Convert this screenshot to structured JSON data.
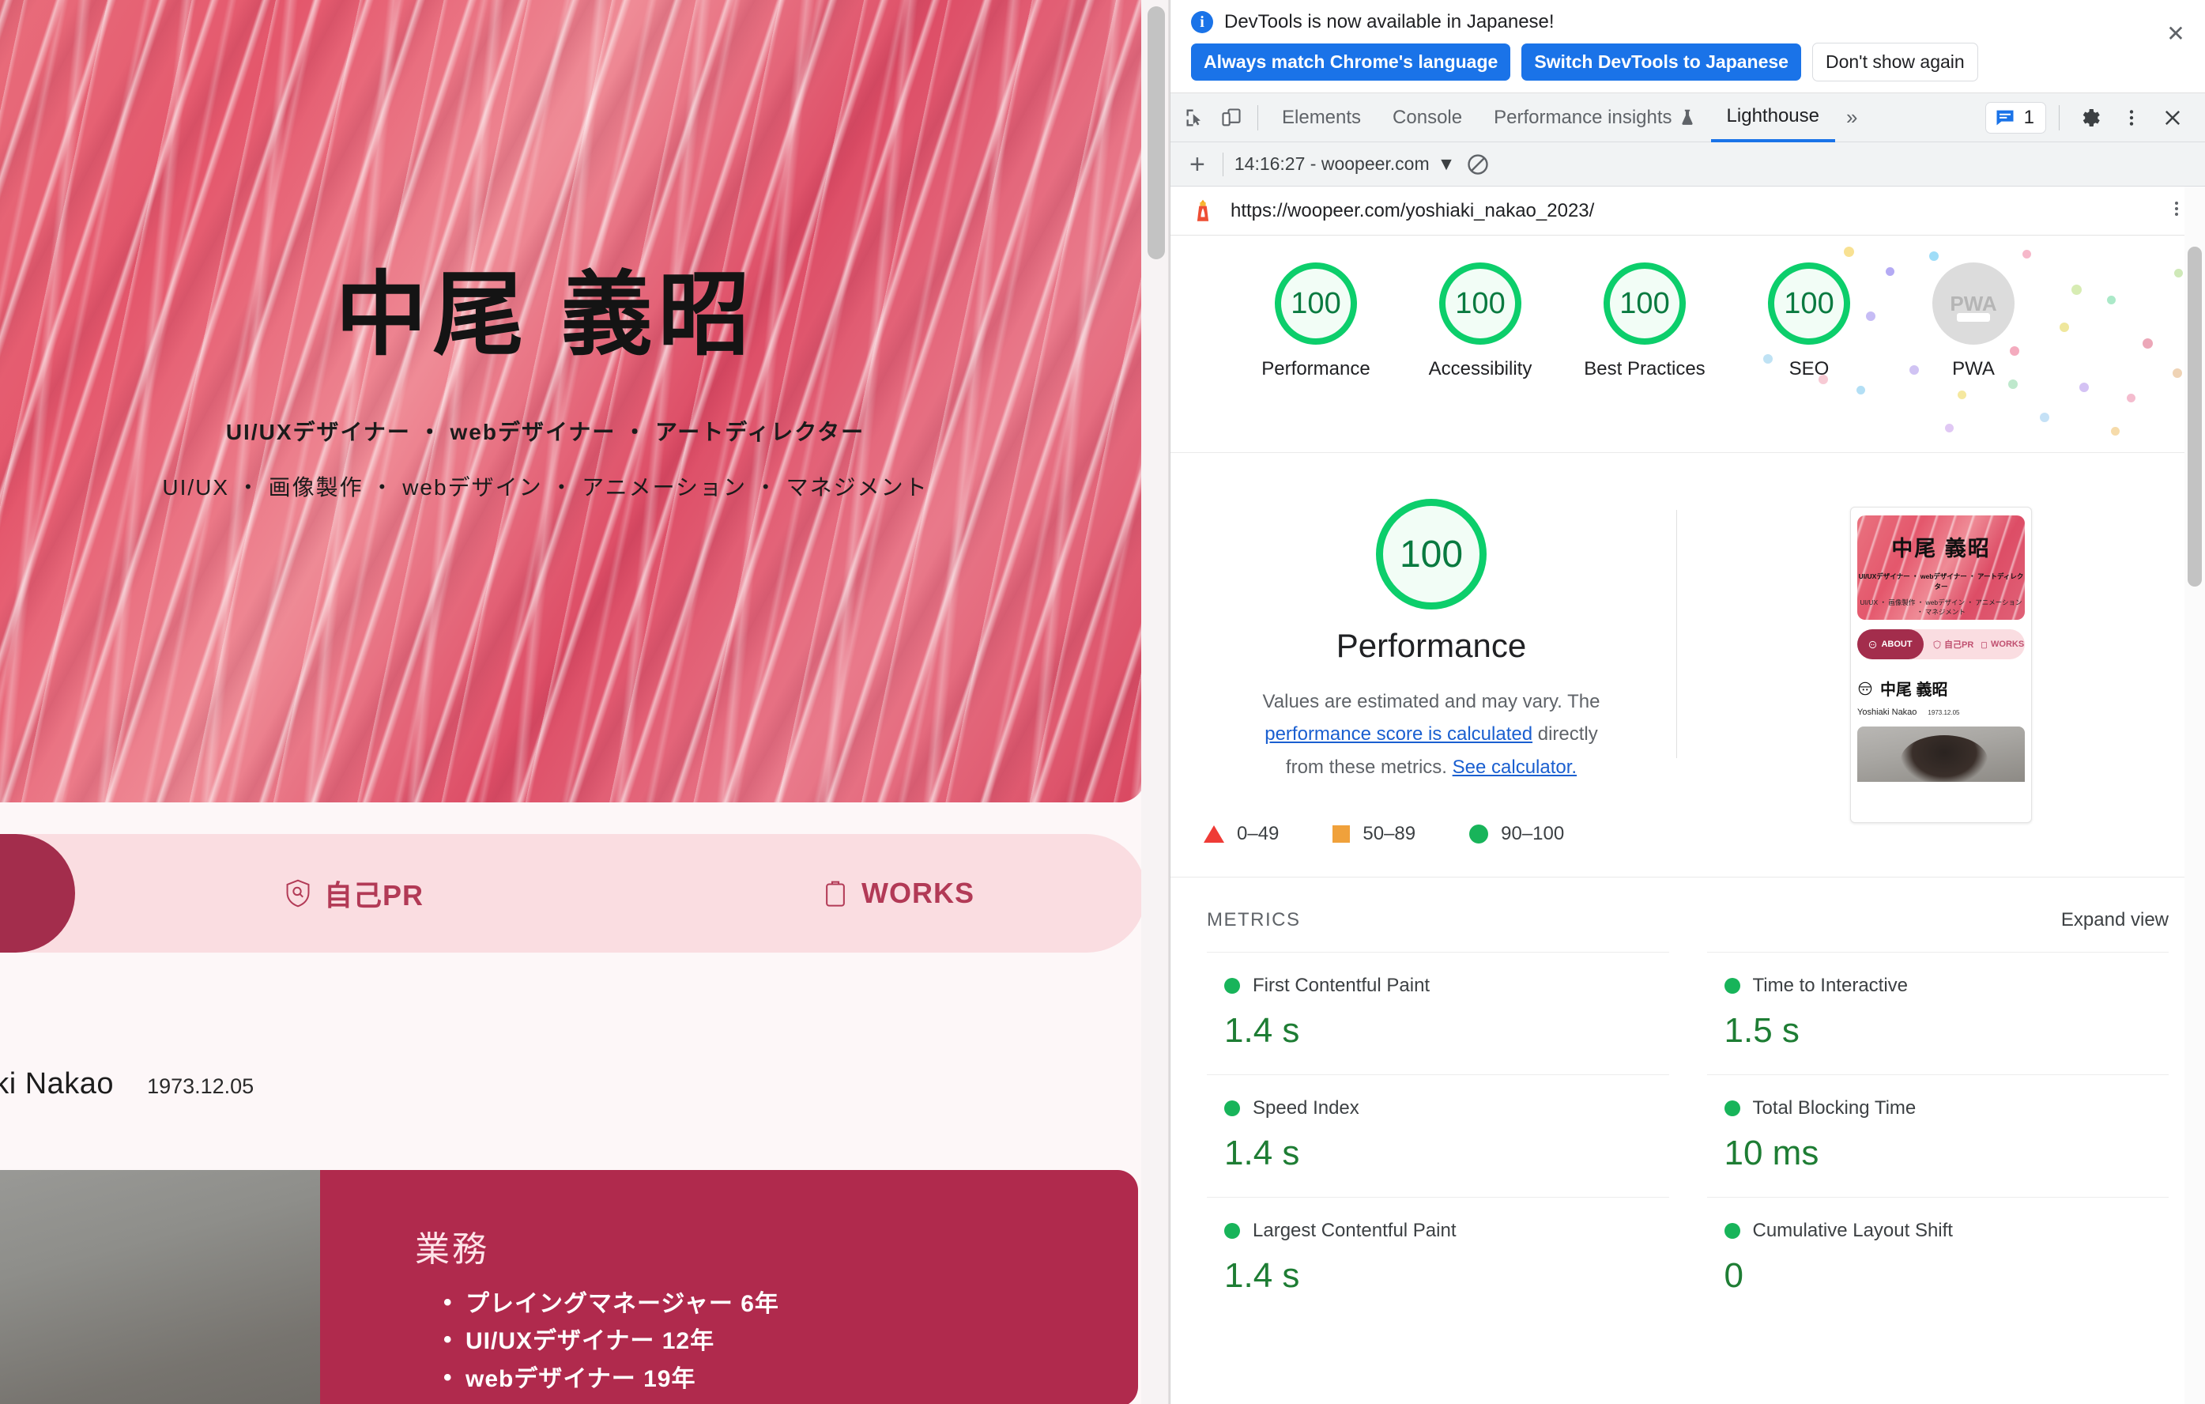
{
  "webpage": {
    "hero": {
      "title": "中尾 義昭",
      "subtitle1": "UI/UXデザイナー ・ webデザイナー ・ アートディレクター",
      "subtitle2": "UI/UX ・ 画像製作 ・ webデザイン ・ アニメーション ・ マネジメント"
    },
    "nav": {
      "self_pr": "自己PR",
      "works": "WORKS"
    },
    "profile": {
      "name_en": "hiaki Nakao",
      "birthdate": "1973.12.05"
    },
    "work_card": {
      "heading": "業務",
      "items": [
        "プレイングマネージャー 6年",
        "UI/UXデザイナー 12年",
        "webデザイナー 19年"
      ]
    }
  },
  "devtools": {
    "infobar": {
      "message": "DevTools is now available in Japanese!",
      "btn_always": "Always match Chrome's language",
      "btn_switch": "Switch DevTools to Japanese",
      "btn_dismiss": "Don't show again",
      "close": "✕"
    },
    "tabs": [
      {
        "label": "Elements",
        "active": false
      },
      {
        "label": "Console",
        "active": false
      },
      {
        "label": "Performance insights",
        "active": false,
        "experimental": true
      },
      {
        "label": "Lighthouse",
        "active": true
      }
    ],
    "more_tabs": "»",
    "issues_count": "1",
    "lighthouse_toolbar": {
      "add": "+",
      "run_label": "14:16:27 - woopeer.com",
      "dropdown_caret": "▼"
    }
  },
  "report": {
    "url": "https://woopeer.com/yoshiaki_nakao_2023/",
    "categories": [
      {
        "label": "Performance",
        "score": "100",
        "state": "pass"
      },
      {
        "label": "Accessibility",
        "score": "100",
        "state": "pass"
      },
      {
        "label": "Best Practices",
        "score": "100",
        "state": "pass"
      },
      {
        "label": "SEO",
        "score": "100",
        "state": "pass"
      },
      {
        "label": "PWA",
        "score": "PWA",
        "state": "na"
      }
    ],
    "performance": {
      "score": "100",
      "title": "Performance",
      "desc_part1": "Values are estimated and may vary. The ",
      "link1": "performance score is calculated",
      "desc_part2": " directly from these metrics. ",
      "link2": "See calculator."
    },
    "legend": [
      {
        "shape": "triangle",
        "label": "0–49",
        "color": "#ef3b36"
      },
      {
        "shape": "square",
        "label": "50–89",
        "color": "#f0a13b"
      },
      {
        "shape": "circle",
        "label": "90–100",
        "color": "#18b45a"
      }
    ],
    "metrics": {
      "section_title": "METRICS",
      "expand_label": "Expand view",
      "items": [
        {
          "name": "First Contentful Paint",
          "value": "1.4 s",
          "state": "pass"
        },
        {
          "name": "Time to Interactive",
          "value": "1.5 s",
          "state": "pass"
        },
        {
          "name": "Speed Index",
          "value": "1.4 s",
          "state": "pass"
        },
        {
          "name": "Total Blocking Time",
          "value": "10 ms",
          "state": "pass"
        },
        {
          "name": "Largest Contentful Paint",
          "value": "1.4 s",
          "state": "pass"
        },
        {
          "name": "Cumulative Layout Shift",
          "value": "0",
          "state": "pass"
        }
      ]
    },
    "thumbnail": {
      "hero_title": "中尾 義昭",
      "hero_sub1": "UI/UXデザイナー ・ webデザイナー ・ アートディレクター",
      "hero_sub2": "UI/UX ・ 画像製作 ・ webデザイン ・ アニメーション ・ マネジメント",
      "nav_about": "ABOUT",
      "nav_self_pr": "自己PR",
      "nav_works": "WORKS",
      "name_jp": "中尾 義昭",
      "name_en": "Yoshiaki Nakao",
      "birthdate": "1973.12.05"
    }
  },
  "colors": {
    "accent_blue": "#1a73e8",
    "pass_green": "#0cce6b",
    "brand_pink": "#e4576c",
    "brand_dark_red": "#a32d4c"
  }
}
